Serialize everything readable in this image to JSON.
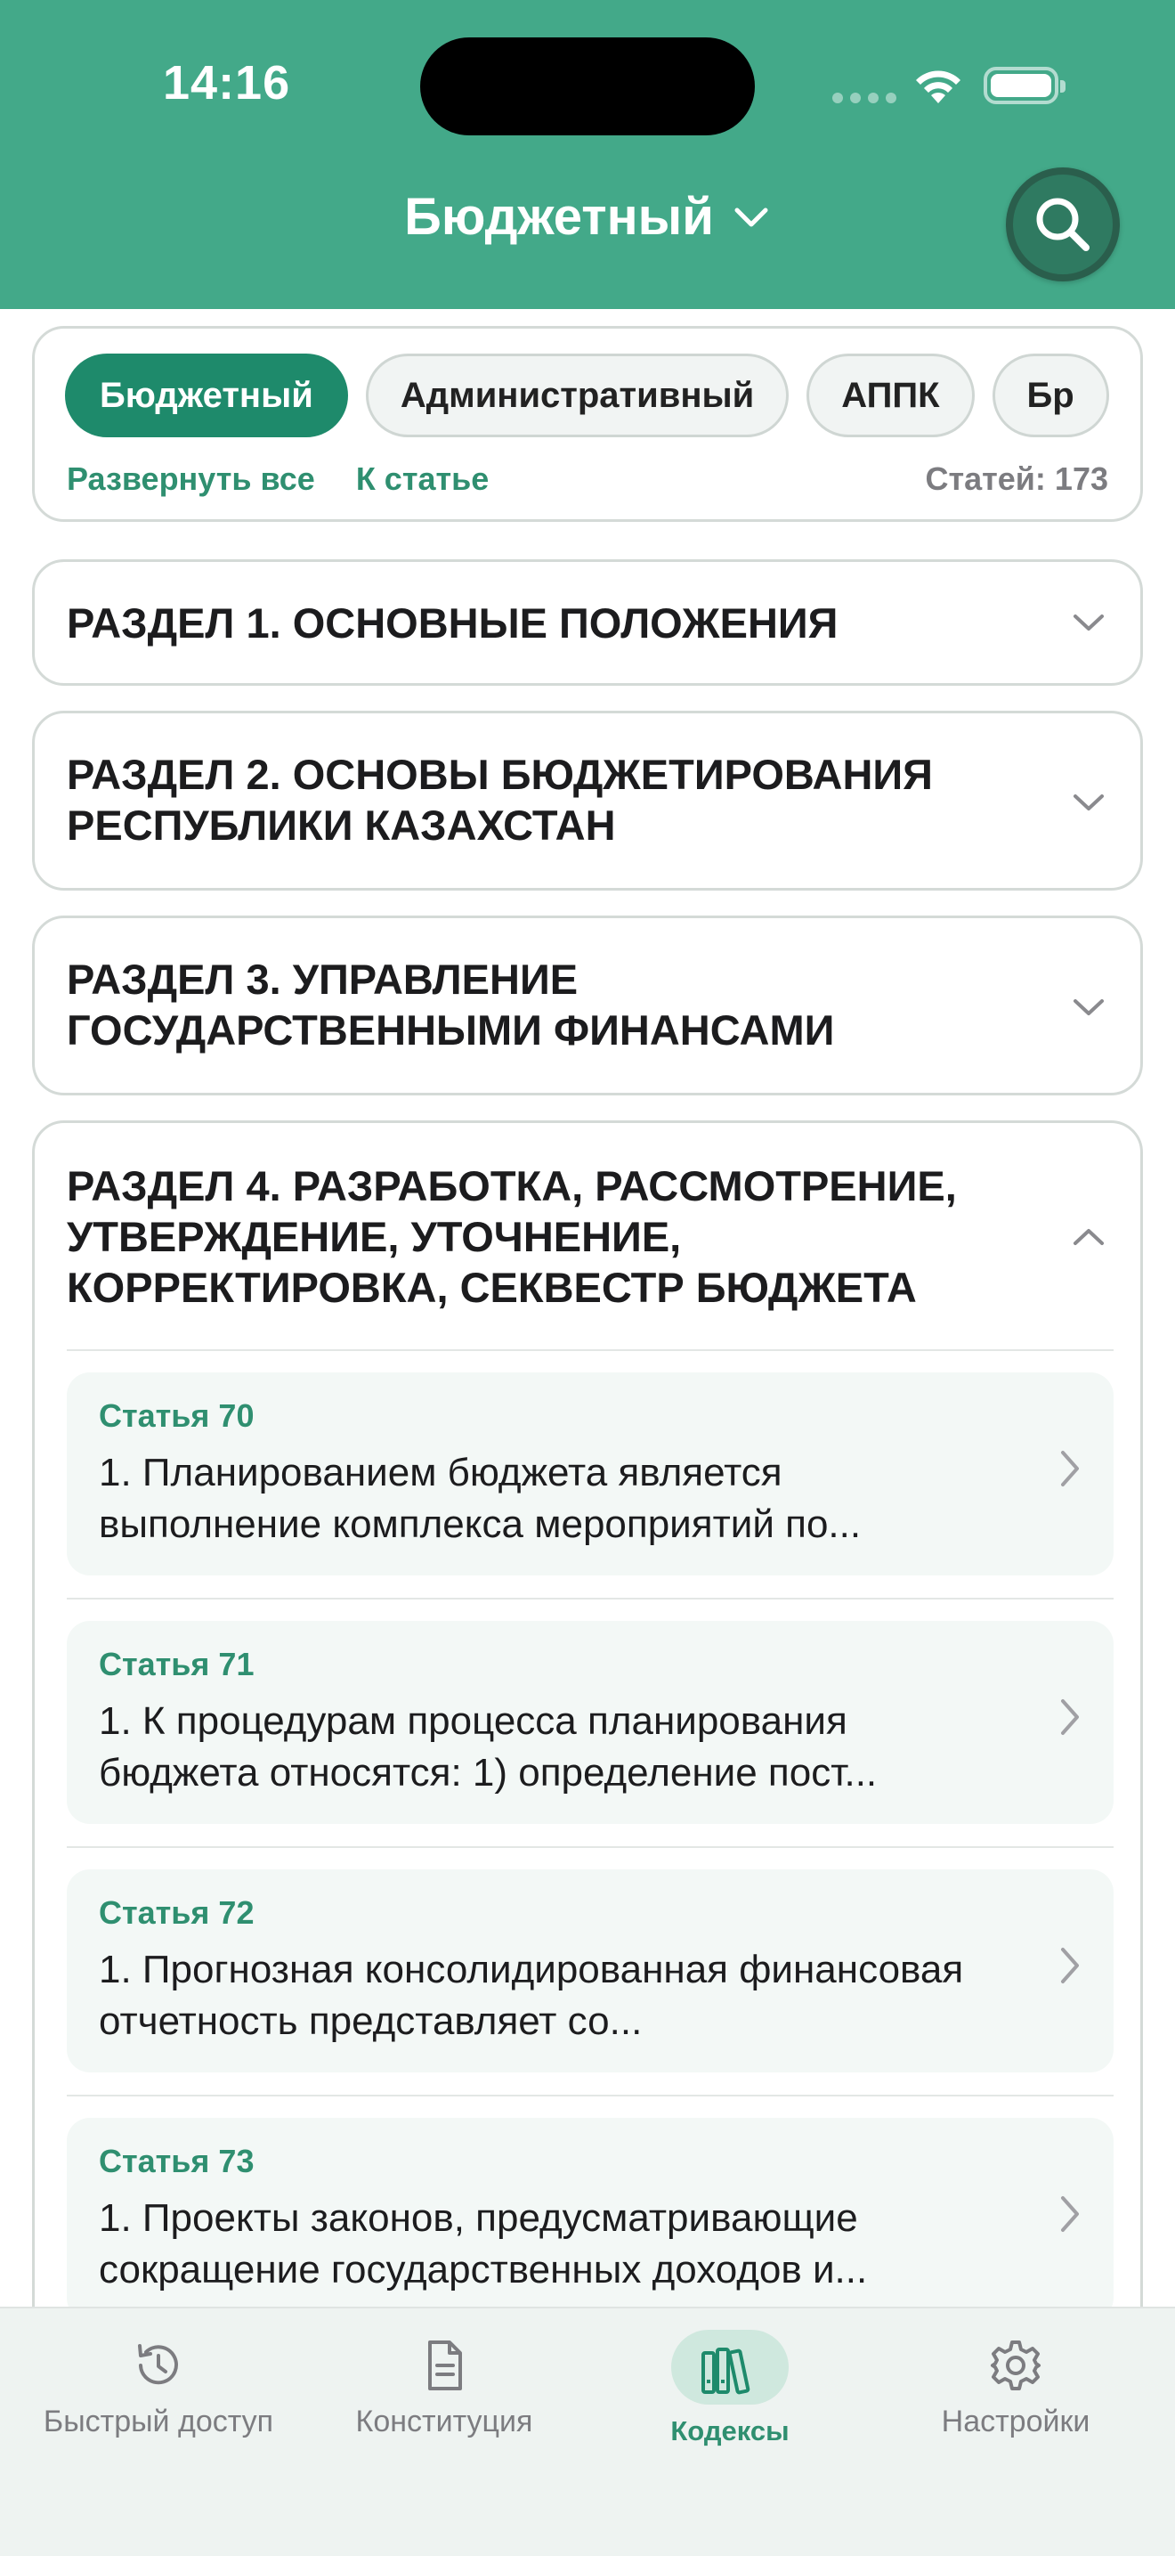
{
  "status_bar": {
    "time": "14:16"
  },
  "header": {
    "title": "Бюджетный"
  },
  "filter": {
    "chips": [
      {
        "label": "Бюджетный",
        "active": true
      },
      {
        "label": "Административный",
        "active": false
      },
      {
        "label": "АППК",
        "active": false
      },
      {
        "label": "Бр",
        "active": false
      }
    ],
    "expand_all": "Развернуть все",
    "to_article": "К статье",
    "count": "Статей: 173"
  },
  "sections": [
    {
      "title": "РАЗДЕЛ 1. ОСНОВНЫЕ ПОЛОЖЕНИЯ",
      "expanded": false
    },
    {
      "title": "РАЗДЕЛ 2. ОСНОВЫ БЮДЖЕТИРОВАНИЯ РЕСПУБЛИКИ КАЗАХСТАН",
      "expanded": false
    },
    {
      "title": "РАЗДЕЛ 3. УПРАВЛЕНИЕ ГОСУДАРСТВЕННЫМИ ФИНАНСАМИ",
      "expanded": false
    },
    {
      "title": "РАЗДЕЛ 4. РАЗРАБОТКА, РАССМОТРЕНИЕ, УТВЕРЖДЕНИЕ, УТОЧНЕНИЕ, КОРРЕКТИРОВКА, СЕКВЕСТР БЮДЖЕТА",
      "expanded": true
    }
  ],
  "articles": [
    {
      "number": "Статья 70",
      "text": "1. Планированием бюджета является выполнение комплекса мероприятий по..."
    },
    {
      "number": "Статья 71",
      "text": "1. К процедурам процесса планирования бюджета относятся: 1) определение пост..."
    },
    {
      "number": "Статья 72",
      "text": "1. Прогнозная консолидированная финансовая отчетность представляет со..."
    },
    {
      "number": "Статья 73",
      "text": "1. Проекты законов, предусматривающие сокращение государственных доходов и..."
    }
  ],
  "tabs": [
    {
      "label": "Быстрый доступ",
      "icon": "history-icon",
      "active": false
    },
    {
      "label": "Конституция",
      "icon": "document-icon",
      "active": false
    },
    {
      "label": "Кодексы",
      "icon": "books-icon",
      "active": true
    },
    {
      "label": "Настройки",
      "icon": "gear-icon",
      "active": false
    }
  ],
  "colors": {
    "primary": "#43a989",
    "accent": "#2f8f70",
    "chip_active": "#1e8a6b"
  }
}
